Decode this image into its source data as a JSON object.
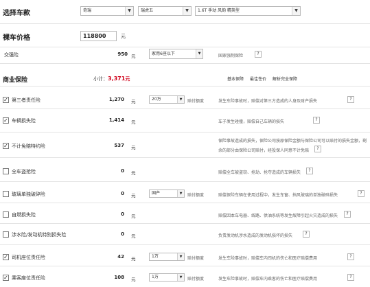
{
  "header": {
    "select_car_label": "选择车款",
    "brand_select": "奇瑞",
    "series_select": "瑞虎五",
    "model_select": "1.6T 手动 风韵 精英型",
    "price_label": "裸车价格",
    "price_value": "118800",
    "price_unit": "元"
  },
  "tax_row": {
    "label": "交强险",
    "amount": "950",
    "unit": "元",
    "select_value": "家用6座以下",
    "desc": "国家强制保险",
    "help": "?"
  },
  "commercial": {
    "title": "商业保险",
    "subtotal_label": "小计：",
    "subtotal_value": "3,371",
    "subtotal_unit": "元",
    "tabs": [
      "基本保障",
      "最佳性价",
      "解析完全保障"
    ]
  },
  "items": [
    {
      "label": "第三者责任险",
      "checked": true,
      "amount": "1,270",
      "unit": "元",
      "select": "20万",
      "tip": "赔付额度",
      "desc": "发生车险事故时，赔偿对第三方造成的人身及财产损失",
      "help": "?"
    },
    {
      "label": "车辆损失险",
      "checked": true,
      "amount": "1,414",
      "unit": "元",
      "select": "",
      "tip": "",
      "desc": "车子发生碰撞，赔偿自己车辆的损失",
      "help": "?"
    },
    {
      "label": "不计免赔特约险",
      "checked": true,
      "amount": "537",
      "unit": "元",
      "select": "",
      "tip": "",
      "desc": "保险事故造成的损失，保险公司按原保险金额与保险公司可以赔付的损失金额，剩",
      "desc2": "余的部分由保险公司赔付，经投保人同意不计免赔",
      "help": "?"
    },
    {
      "label": "全车盗抢险",
      "checked": false,
      "amount": "0",
      "unit": "元",
      "select": "",
      "tip": "",
      "desc": "赔偿全车被盗窃、抢劫、抢夺造成的车辆损失",
      "help": "?"
    },
    {
      "label": "玻璃单独破碎险",
      "checked": false,
      "amount": "0",
      "unit": "元",
      "select": "国产",
      "tip": "赔付额度",
      "desc": "赔偿保险车辆在使用过程中，发生车窗、挡风玻璃的单独破碎损失",
      "help": "?"
    },
    {
      "label": "自燃损失险",
      "checked": false,
      "amount": "0",
      "unit": "元",
      "select": "",
      "tip": "",
      "desc": "赔偿因本车电器、线路、供油系统等发生故障引起火灾造成的损失",
      "help": "?"
    },
    {
      "label": "涉水险/发动机特别损失险",
      "checked": false,
      "amount": "0",
      "unit": "元",
      "select": "",
      "tip": "",
      "desc": "负责发动机涉水造成的发动机损坏的损失",
      "help": "?"
    },
    {
      "label": "司机座位责任险",
      "checked": true,
      "amount": "42",
      "unit": "元",
      "select": "1万",
      "tip": "赔付额度",
      "desc": "发生车险事故时，赔偿车内司机的伤亡和医疗赔偿费用",
      "help": "?"
    },
    {
      "label": "乘客座位责任险",
      "checked": true,
      "amount": "108",
      "unit": "元",
      "select": "1万",
      "tip": "赔付额度",
      "desc": "发生车险事故时，赔偿车内乘客的伤亡和医疗赔偿费用",
      "help": "?"
    }
  ]
}
